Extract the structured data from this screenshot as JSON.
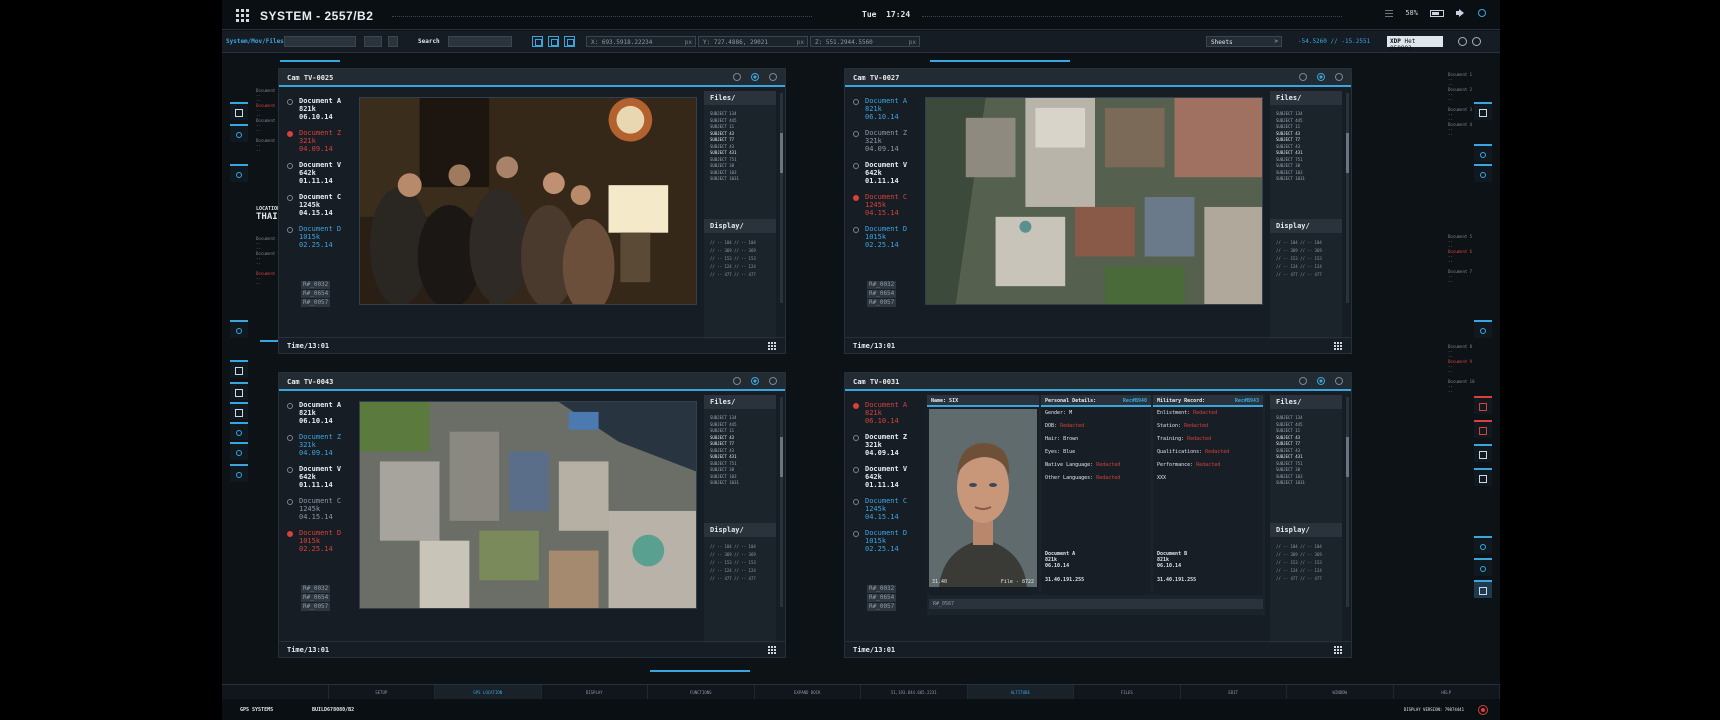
{
  "topbar": {
    "title": "SYSTEM - 2557/B2",
    "day": "Tue",
    "time": "17:24",
    "battery": "58%"
  },
  "toolbar": {
    "path": "System/Mov/Files",
    "search_label": "Search",
    "coord_x": "X: 693.5918.22234",
    "coord_y": "Y: 727.4886, 29021",
    "coord_z": "Z: 551.2944.5560",
    "unit": "px",
    "sheets": "Sheets",
    "latlon": "-54.5260  // -15.2551",
    "xdp_label": "XDP",
    "xdp_value": "Het 058993"
  },
  "location": {
    "label": "LOCATION",
    "value": "THAIL"
  },
  "panels": [
    {
      "cam": "Cam TV-0025",
      "time": "Time/13:01",
      "view": "party",
      "docs": [
        {
          "name": "Document A",
          "size": "821k",
          "date": "06.10.14",
          "style": "white"
        },
        {
          "name": "Document Z",
          "size": "321k",
          "date": "04.09.14",
          "style": "red"
        },
        {
          "name": "Document V",
          "size": "642k",
          "date": "01.11.14",
          "style": "white"
        },
        {
          "name": "Document C",
          "size": "1245k",
          "date": "04.15.14",
          "style": "white"
        },
        {
          "name": "Document D",
          "size": "1015k",
          "date": "02.25.14",
          "style": "blue"
        }
      ]
    },
    {
      "cam": "Cam TV-0027",
      "time": "Time/13:01",
      "view": "aerial1",
      "docs": [
        {
          "name": "Document A",
          "size": "821k",
          "date": "06.10.14",
          "style": "blue"
        },
        {
          "name": "Document Z",
          "size": "321k",
          "date": "04.09.14",
          "style": "grey"
        },
        {
          "name": "Document V",
          "size": "642k",
          "date": "01.11.14",
          "style": "white"
        },
        {
          "name": "Document C",
          "size": "1245k",
          "date": "04.15.14",
          "style": "red"
        },
        {
          "name": "Document D",
          "size": "1015k",
          "date": "02.25.14",
          "style": "blue"
        }
      ]
    },
    {
      "cam": "Cam TV-0043",
      "time": "Time/13:01",
      "view": "aerial2",
      "docs": [
        {
          "name": "Document A",
          "size": "821k",
          "date": "06.10.14",
          "style": "white"
        },
        {
          "name": "Document Z",
          "size": "321k",
          "date": "04.09.14",
          "style": "blue"
        },
        {
          "name": "Document V",
          "size": "642k",
          "date": "01.11.14",
          "style": "white"
        },
        {
          "name": "Document C",
          "size": "1245k",
          "date": "04.15.14",
          "style": "grey"
        },
        {
          "name": "Document D",
          "size": "1015k",
          "date": "02.25.14",
          "style": "red"
        }
      ]
    },
    {
      "cam": "Cam TV-0031",
      "time": "Time/13:01",
      "view": "profile",
      "docs": [
        {
          "name": "Document A",
          "size": "821k",
          "date": "06.10.14",
          "style": "red"
        },
        {
          "name": "Document Z",
          "size": "321k",
          "date": "04.09.14",
          "style": "white"
        },
        {
          "name": "Document V",
          "size": "642k",
          "date": "01.11.14",
          "style": "white"
        },
        {
          "name": "Document C",
          "size": "1245k",
          "date": "04.15.14",
          "style": "blue"
        },
        {
          "name": "Document D",
          "size": "1015k",
          "date": "02.25.14",
          "style": "blue"
        }
      ]
    }
  ],
  "refs": [
    "R#_0032",
    "R#_0654",
    "R#_0057"
  ],
  "files_title": "Files/",
  "display_title": "Display/",
  "subjects": [
    "SUBJECT 134",
    "SUBJECT 445",
    "SUBJECT 11",
    "SUBJECT 43",
    "SUBJECT 77",
    "SUBJECT 43",
    "SUBJECT 431",
    "SUBJECT 751",
    "SUBJECT 38",
    "SUBJECT 103",
    "SUBJECT 1031"
  ],
  "display_rows": [
    "// -- 104  // -- 104",
    "// -- 369  // -- 369",
    "// -- 153  // -- 153",
    "// -- 124  // -- 124",
    "// -- 477  // -- 477"
  ],
  "profile": {
    "name": "Name: SIX",
    "personal_title": "Personal Details:",
    "personal_rec": "Rec#B940",
    "military_title": "Military Record:",
    "military_rec": "Rec#B943",
    "personal": [
      {
        "k": "Gender:",
        "v": "M",
        "red": false
      },
      {
        "k": "DOB:",
        "v": "Redacted",
        "red": true
      },
      {
        "k": "Hair:",
        "v": "Brown",
        "red": false
      },
      {
        "k": "Eyes:",
        "v": "Blue",
        "red": false
      },
      {
        "k": "Native Language:",
        "v": "Redacted",
        "red": true
      },
      {
        "k": "Other Languages:",
        "v": "Redacted",
        "red": true
      }
    ],
    "military": [
      {
        "k": "Enlistment:",
        "v": "Redacted",
        "red": true
      },
      {
        "k": "Station:",
        "v": "Redacted",
        "red": true
      },
      {
        "k": "Training:",
        "v": "Redacted",
        "red": true
      },
      {
        "k": "Qualifications:",
        "v": "Redacted",
        "red": true
      },
      {
        "k": "Performance:",
        "v": "Redacted",
        "red": true
      },
      {
        "k": "XXX",
        "v": "",
        "red": false
      }
    ],
    "photo_left": "31.40",
    "photo_right": "File - 8722",
    "doc_a": {
      "name": "Document A",
      "size": "821k",
      "date": "06.10.14",
      "ip": "31.40.191.255"
    },
    "doc_b": {
      "name": "Document B",
      "size": "821k",
      "date": "06.10.14",
      "ip": "31.40.191.255"
    },
    "ref": "R#_0567"
  },
  "bottom_tabs": [
    {
      "label": "",
      "active": false
    },
    {
      "label": "SETUP",
      "active": false
    },
    {
      "label": "GPS LOCATION",
      "active": true
    },
    {
      "label": "DISPLAY",
      "active": false
    },
    {
      "label": "FUNCTIONS",
      "active": false
    },
    {
      "label": "EXPAND DOCK",
      "active": false
    },
    {
      "label": "51,193.844.605.2231",
      "active": false
    },
    {
      "label": "ALTITUDE",
      "active": true
    },
    {
      "label": "FILES",
      "active": false
    },
    {
      "label": "EDIT",
      "active": false
    },
    {
      "label": "WINDOW",
      "active": false
    },
    {
      "label": "HELP",
      "active": false
    }
  ],
  "footer": {
    "left": "GPS SYSTEMS",
    "build": "BUILD678080/B2",
    "right": "DISPLAY VERSION: 79874441"
  },
  "colors": {
    "accent": "#3aa6e0",
    "alert": "#d9413b",
    "bg": "#0d1217"
  }
}
